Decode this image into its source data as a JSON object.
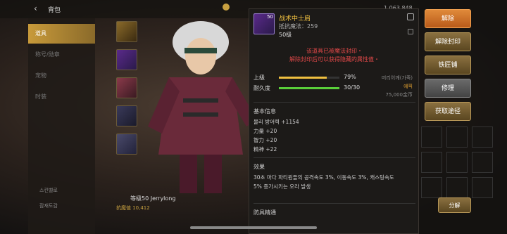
{
  "topbar": {
    "title": "背包",
    "gold_text": "1,063,848"
  },
  "sidebar": {
    "items": [
      {
        "label": "道具"
      },
      {
        "label": "称号/勋章"
      },
      {
        "label": "宠物"
      },
      {
        "label": "时装"
      }
    ],
    "bottom_links": [
      "스킨밸로",
      "잠재도감"
    ]
  },
  "character": {
    "level_name": "等级50 Jerrylong",
    "power_text": "抗魔值 10,412"
  },
  "tooltip": {
    "item_name": "战术中士肩",
    "icon_label": "50",
    "resist": "抵抗魔法：259",
    "level": "50级",
    "seal_line1": "该道具已被魔法封印・",
    "seal_line2": "解除封印后可以获得隐藏的属性值・",
    "grade_label": "上级",
    "grade_percent": "79%",
    "grade_fill": 0.79,
    "grade_right": "머리어깨(가죽)",
    "durability_label": "耐久度",
    "durability_value": "30/30",
    "durability_fill": 1.0,
    "rarity": "에픽",
    "price": "75,000金币",
    "basic_title": "基本信息",
    "stats": [
      "물리 방어력 +1154",
      "力量 +20",
      "智力 +20",
      "精神 +22"
    ],
    "effect_title": "效果",
    "effect_line1": "30초 마다 파티원들의 공격속도 3%, 이동속도 3%, 캐스팅속도",
    "effect_line2": "5% 증가시키는 오라 발생",
    "armor_title": "防具精通"
  },
  "actions": {
    "dismantle": "解除",
    "unseal": "解除封印",
    "smith": "铁匠铺",
    "repair": "修理",
    "obtain": "获取途径",
    "decompose": "分解"
  },
  "colors": {
    "accent_orange": "#e08a3a",
    "item_name": "#f0c040",
    "seal_red": "#e04848",
    "grade_bar": "#f0c040",
    "durability_bar": "#5ad03a",
    "rarity_epic": "#e0a030"
  }
}
